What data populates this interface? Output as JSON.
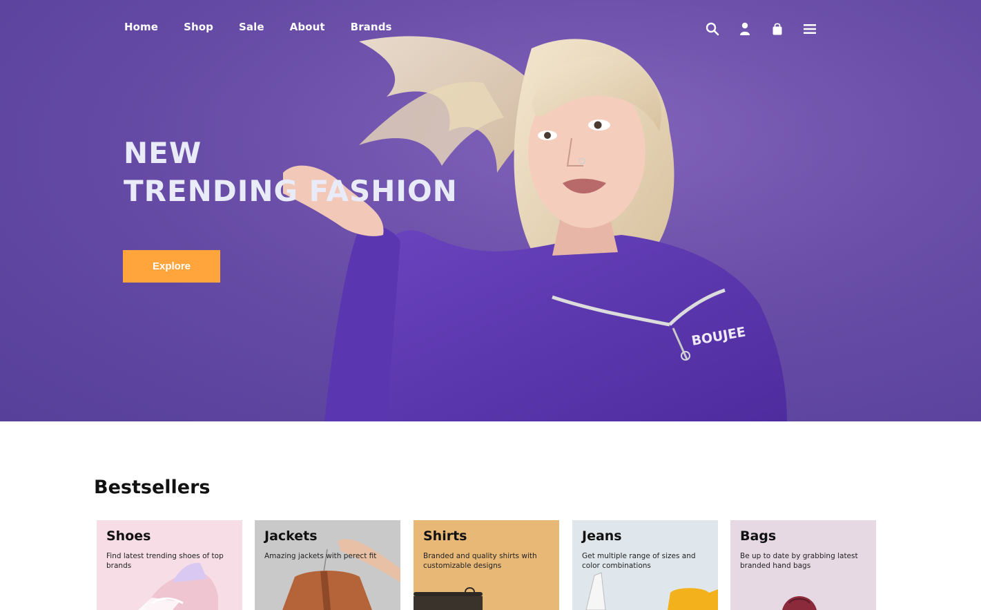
{
  "nav": {
    "links": [
      "Home",
      "Shop",
      "Sale",
      "About",
      "Brands"
    ],
    "icons": [
      "search-icon",
      "user-icon",
      "shopping-bag-icon",
      "menu-icon"
    ]
  },
  "hero": {
    "title_line1": "NEW",
    "title_line2": "TRENDING FASHION",
    "cta_label": "Explore",
    "background_color": "#6a4ea8",
    "cta_color": "#ffa53c",
    "jacket_logo": "BOUJEE"
  },
  "bestsellers": {
    "heading": "Bestsellers",
    "cards": [
      {
        "title": "Shoes",
        "description": "Find latest trending shoes of top brands",
        "bg": "#f6dde6"
      },
      {
        "title": "Jackets",
        "description": "Amazing jackets with perect fit",
        "bg": "#c9c9c9"
      },
      {
        "title": "Shirts",
        "description": "Branded and quality shirts with customizable designs",
        "bg": "#e8b877"
      },
      {
        "title": "Jeans",
        "description": "Get multiple range of sizes and color combinations",
        "bg": "#dfe7ec"
      },
      {
        "title": "Bags",
        "description": "Be up to date by grabbing latest branded hand bags",
        "bg": "#e6d9e3"
      }
    ]
  }
}
